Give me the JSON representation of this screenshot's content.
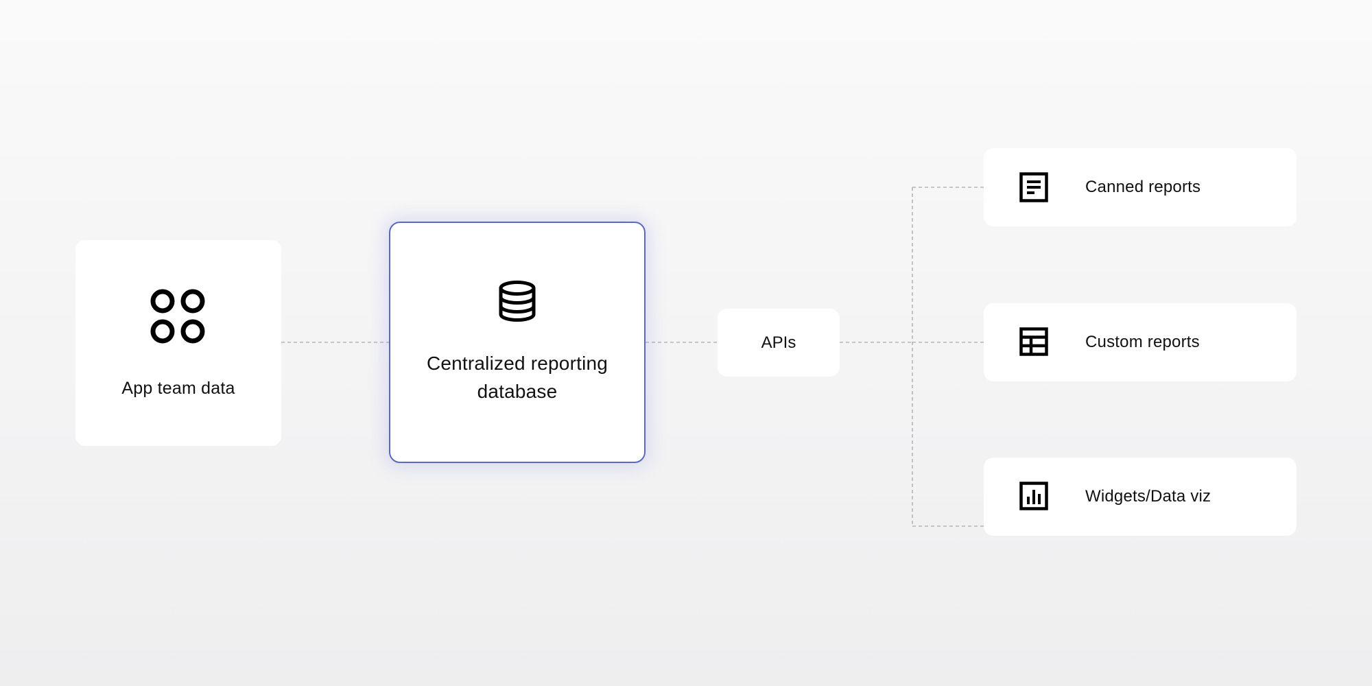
{
  "source": {
    "label": "App team data",
    "icon": "apps-grid-icon"
  },
  "hub": {
    "label": "Centralized reporting database",
    "icon": "database-icon",
    "accent_color": "#5a68bd"
  },
  "api": {
    "label": "APIs"
  },
  "outputs": [
    {
      "label": "Canned reports",
      "icon": "document-icon"
    },
    {
      "label": "Custom reports",
      "icon": "table-icon"
    },
    {
      "label": "Widgets/Data viz",
      "icon": "bar-chart-icon"
    }
  ],
  "connector_color": "#b5b5b5"
}
